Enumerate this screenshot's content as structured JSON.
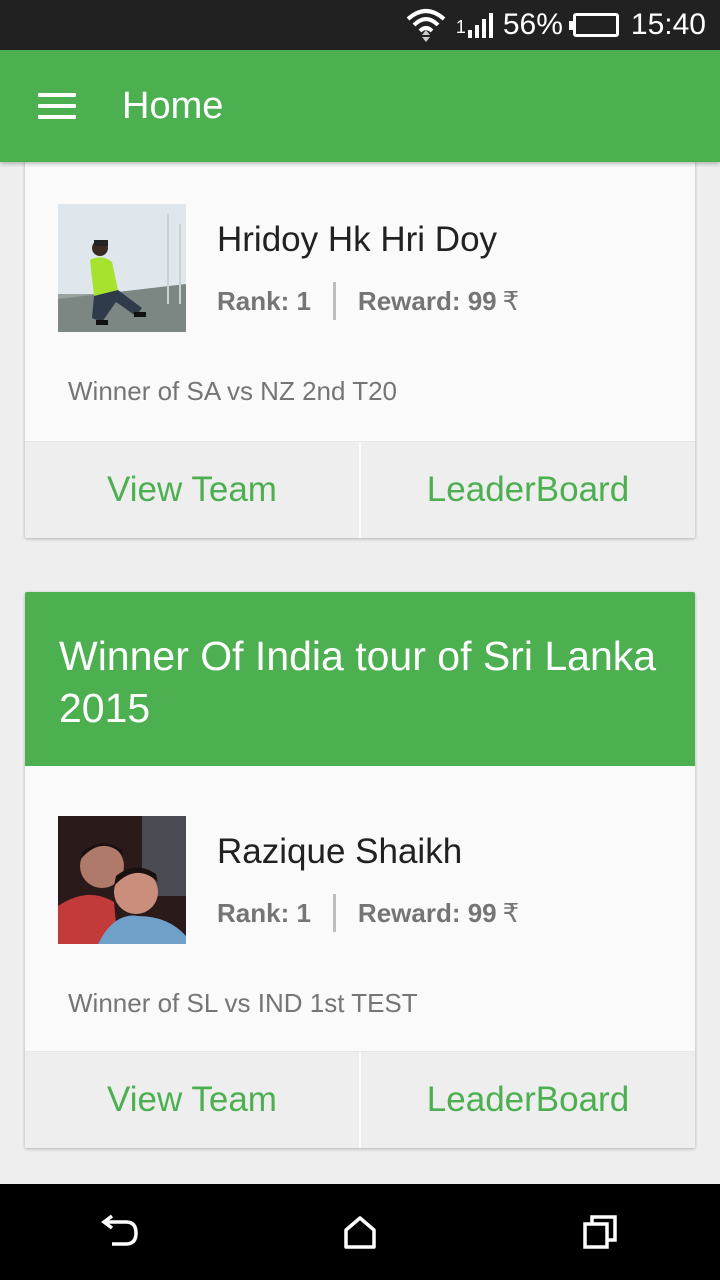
{
  "status_bar": {
    "battery_percent": "56%",
    "battery_level": 0.56,
    "time": "15:40",
    "signal_label": "1",
    "icons": [
      "wifi-icon",
      "signal-icon",
      "battery-icon"
    ]
  },
  "app_bar": {
    "title": "Home",
    "menu_icon": "menu-icon"
  },
  "colors": {
    "primary": "#4caf50",
    "status_bar": "#212121",
    "background": "#eeeeee",
    "card": "#fafafa",
    "text_secondary": "#757575"
  },
  "cards": [
    {
      "winner": {
        "name": "Hridoy Hk Hri Doy",
        "rank": "Rank: 1",
        "reward": "Reward: 99",
        "currency": "₹",
        "description": "Winner of SA vs NZ 2nd T20"
      },
      "actions": {
        "view_team": "View Team",
        "leaderboard": "LeaderBoard"
      }
    },
    {
      "header": "Winner Of India tour of Sri Lanka 2015",
      "winner": {
        "name": "Razique Shaikh",
        "rank": "Rank: 1",
        "reward": "Reward: 99",
        "currency": "₹",
        "description": "Winner of SL vs IND 1st TEST"
      },
      "actions": {
        "view_team": "View Team",
        "leaderboard": "LeaderBoard"
      }
    }
  ],
  "nav_bar": {
    "icons": [
      "back-icon",
      "home-icon",
      "recents-icon"
    ]
  }
}
